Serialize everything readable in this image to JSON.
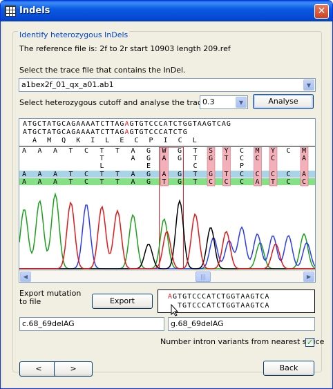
{
  "window": {
    "title": "Indels",
    "close_glyph": "✕"
  },
  "group": {
    "title": "Identify heterozygous InDels"
  },
  "reference_text": "The reference file is: 2f to 2r start 10903 length 209.ref",
  "trace_label": "Select the trace file that contains the InDel.",
  "trace_file": {
    "value": "a1bex2f_01_qx_a01.ab1"
  },
  "cutoff_label": "Select heterozygous cutoff and analyse the trace file.",
  "cutoff": {
    "value": "0.3"
  },
  "analyse_label": "Analyse",
  "sequence_header": {
    "line1_before": "ATGCTATGCAGAAAATCTTAG",
    "line1_mark": "A",
    "line1_after": "GTGTCCCATCTGGTAAGTCAG",
    "line2_before": "ATGCTATGCAGAAAATCTTAG",
    "line2_mark": "A",
    "line2_after": "GTGTCCCATCTG",
    "translation": "  A  M  Q  K  I  L  E  C  P  I  C  L"
  },
  "trace_columns": [
    {
      "row1": "A",
      "row2": "",
      "row3": "",
      "row4": "A",
      "row5": "A",
      "highlight": false
    },
    {
      "row1": "A",
      "row2": "",
      "row3": "",
      "row4": "A",
      "row5": "A",
      "highlight": false
    },
    {
      "row1": "A",
      "row2": "",
      "row3": "",
      "row4": "A",
      "row5": "A",
      "highlight": false
    },
    {
      "row1": "T",
      "row2": "",
      "row3": "",
      "row4": "T",
      "row5": "T",
      "highlight": false
    },
    {
      "row1": "C",
      "row2": "",
      "row3": "",
      "row4": "C",
      "row5": "C",
      "highlight": false
    },
    {
      "row1": "T",
      "row2": "T",
      "row3": "L",
      "row4": "T",
      "row5": "T",
      "highlight": false
    },
    {
      "row1": "T",
      "row2": "",
      "row3": "",
      "row4": "T",
      "row5": "T",
      "highlight": false
    },
    {
      "row1": "A",
      "row2": "A",
      "row3": "",
      "row4": "A",
      "row5": "A",
      "highlight": false
    },
    {
      "row1": "G",
      "row2": "G",
      "row3": "E",
      "row4": "G",
      "row5": "G",
      "highlight": false
    },
    {
      "row1": "W",
      "row2": "A",
      "row3": "",
      "row4": "A",
      "row5": "T",
      "highlight": true
    },
    {
      "row1": "G",
      "row2": "G",
      "row3": "",
      "row4": "G",
      "row5": "G",
      "highlight": false
    },
    {
      "row1": "T",
      "row2": "T",
      "row3": "C",
      "row4": "T",
      "row5": "T",
      "highlight": false
    },
    {
      "row1": "S",
      "row2": "G",
      "row3": "",
      "row4": "G",
      "row5": "C",
      "highlight": true
    },
    {
      "row1": "Y",
      "row2": "T",
      "row3": "",
      "row4": "T",
      "row5": "C",
      "highlight": true
    },
    {
      "row1": "C",
      "row2": "C",
      "row3": "P",
      "row4": "C",
      "row5": "C",
      "highlight": false
    },
    {
      "row1": "M",
      "row2": "C",
      "row3": "",
      "row4": "C",
      "row5": "A",
      "highlight": true
    },
    {
      "row1": "Y",
      "row2": "C",
      "row3": "",
      "row4": "C",
      "row5": "T",
      "highlight": true
    },
    {
      "row1": "C",
      "row2": "",
      "row3": "",
      "row4": "C",
      "row5": "C",
      "highlight": false
    },
    {
      "row1": "M",
      "row2": "A",
      "row3": "",
      "row4": "A",
      "row5": "C",
      "highlight": true
    }
  ],
  "colors": {
    "trace_A": "#1aa01a",
    "trace_C": "#2a3cf0",
    "trace_G": "#000000",
    "trace_T": "#e01818",
    "row_blue": "#a9d3e6",
    "row_green": "#86e086",
    "highlight_cell": "#f4b0b8",
    "mark_red": "#e8202a"
  },
  "export_label": "Export mutation to file",
  "export_button": "Export",
  "mutation_seq": {
    "line1_mark": "A",
    "line1_rest": "GTGTCCCATCTGGTAAGTCA",
    "line2": "  TGTCCCATCTGGTAAGTCA"
  },
  "c_notation": "c.68_69delAG",
  "g_notation": "g.68_69delAG",
  "intron_label": "Number intron variants from nearest splice",
  "intron_checked": "✓",
  "nav": {
    "prev": "<",
    "next": ">"
  },
  "back_label": "Back",
  "icons": {
    "dropdown": "▼",
    "scroll_left": "◀",
    "scroll_right": "▶",
    "thumb_grip": "|||"
  }
}
